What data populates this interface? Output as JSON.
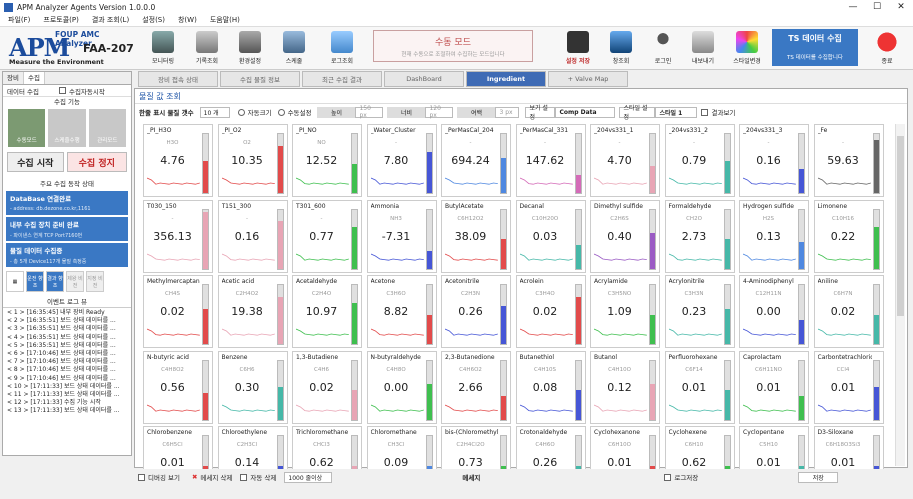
{
  "window": {
    "title": "APM Analyzer Agents Version 1.0.0.0"
  },
  "menu": [
    "파일(F)",
    "프로토콜(P)",
    "결과 조회(L)",
    "설정(S)",
    "창(W)",
    "도움말(H)"
  ],
  "logo": {
    "brand": "APM",
    "subtitle": "FOUP AMC Analyzer",
    "model": "FAA-207",
    "tagline": "Measure the Environment"
  },
  "toolbar": {
    "buttons": [
      "모니터링",
      "기록조회",
      "환경설정",
      "스케줄",
      "로그조회"
    ],
    "mode_title": "수동 모드",
    "mode_sub": "현재 수동으로 조절하여 수집하는 모드입니다",
    "save": "설정 저장",
    "right": [
      "창조회",
      "로그인",
      "내보내기",
      "스타일변경"
    ],
    "exit": "종료",
    "ts_title": "TS 데이터 수집",
    "ts_sub": "TS 데이터를 수집합니다"
  },
  "left": {
    "tabs": [
      "장비",
      "수집"
    ],
    "collect_label": "데이터 수집",
    "auto_label": "수집자동시작",
    "func_title": "수집 기능",
    "modes": [
      "수동모드",
      "스케줄수행",
      "관리모드"
    ],
    "start": "수집 시작",
    "stop": "수집 정지",
    "status_title": "주요 수집 동작 상태",
    "status": [
      {
        "a": "DataBase 연결완료",
        "b": "- address: db.dezone.co.kr,1161"
      },
      {
        "a": "내부 수집 장치 준비 완료",
        "b": "- 파이낸스 연계 TCP Port7160번"
      },
      {
        "a": "물질 데이터 수집중",
        "b": "- 총 5개 Device117개 물질 측정중"
      }
    ],
    "small_btns": [
      "",
      "운전 향조",
      "결과 향조",
      "제왕 비전",
      "지정 비전",
      "",
      "",
      "",
      "",
      ""
    ],
    "log_title": "이벤트 로그 뷰",
    "logs": [
      "< 1 > [16:35:45] 내부 장비 Ready",
      "< 2 > [16:35:51] 보드 상태 데이터를 ...",
      "< 3 > [16:35:51] 보드 상태 데이터를 ...",
      "< 4 > [16:35:51] 보드 상태 데이터를 ...",
      "< 5 > [16:35:51] 보드 상태 데이터를 ...",
      "< 6 > [17:10:46] 보드 상태 데이터를 ...",
      "< 7 > [17:10:46] 보드 상태 데이터를 ...",
      "< 8 > [17:10:46] 보드 상태 데이터를 ...",
      "< 9 > [17:10:46] 보드 상태 데이터를 ...",
      "< 10 > [17:11:33] 보드 상태 데이터를 ...",
      "< 11 > [17:11:33] 보드 상태 데이터를 ...",
      "< 12 > [17:11:33] 수집 기능 시작",
      "< 13 > [17:11:33] 보드 상태 데이터를 ..."
    ]
  },
  "tabs": [
    "장비 접속 상태",
    "수집 물질 정보",
    "최근 수집 결과",
    "DashBoard",
    "Ingredient",
    "+ Valve Map"
  ],
  "main": {
    "title": "물질 값 조회",
    "row_label": "한줄 표시 물질 갯수",
    "row_count": "10 개",
    "auto_size": "자동크기",
    "manual": "수동설정",
    "w_label": "높이",
    "w_val": "150 px",
    "h_label": "너비",
    "h_val": "120 px",
    "gap_label": "여백",
    "gap_val": "3 px",
    "view_label": "보기 설정",
    "view_val": "Comp Data",
    "style_set": "스타일 설정",
    "style_val": "스타일 1",
    "graph": "결과보기"
  },
  "cards": [
    {
      "n": "_PI_H3O",
      "f": "H3O",
      "v": "4.76",
      "c": "#e24b4b",
      "p": 0.55
    },
    {
      "n": "_PI_O2",
      "f": "O2",
      "v": "10.35",
      "c": "#e24b4b",
      "p": 0.8
    },
    {
      "n": "_PI_NO",
      "f": "NO",
      "v": "12.52",
      "c": "#3fbf4f",
      "p": 0.5
    },
    {
      "n": "_Water_Cluster",
      "f": "-",
      "v": "7.80",
      "c": "#4656d6",
      "p": 0.7
    },
    {
      "n": "_PerMasCal_204",
      "f": "-",
      "v": "694.24",
      "c": "#4f88e0",
      "p": 0.6
    },
    {
      "n": "_PerMasCal_331",
      "f": "-",
      "v": "147.62",
      "c": "#d46bb8",
      "p": 0.3
    },
    {
      "n": "_204vs331_1",
      "f": "-",
      "v": "4.70",
      "c": "#e8a5b5",
      "p": 0.45
    },
    {
      "n": "_204vs331_2",
      "f": "-",
      "v": "0.79",
      "c": "#46b8a8",
      "p": 0.55
    },
    {
      "n": "_204vs331_3",
      "f": "-",
      "v": "0.16",
      "c": "#4656d6",
      "p": 0.4
    },
    {
      "n": "_Fe",
      "f": "-",
      "v": "59.63",
      "c": "#666",
      "p": 0.9
    },
    {
      "n": "T030_150",
      "f": "-",
      "v": "356.13",
      "c": "#e8a5b5",
      "p": 0.95
    },
    {
      "n": "T151_300",
      "f": "-",
      "v": "0.16",
      "c": "#e8a5b5",
      "p": 0.8
    },
    {
      "n": "T301_600",
      "f": "-",
      "v": "0.77",
      "c": "#3fbf4f",
      "p": 0.7
    },
    {
      "n": "Ammonia",
      "f": "NH3",
      "v": "-7.31",
      "c": "#4656d6",
      "p": 0.3
    },
    {
      "n": "ButylAcetate",
      "f": "C6H12O2",
      "v": "38.09",
      "c": "#e24b4b",
      "p": 0.5
    },
    {
      "n": "Decanal",
      "f": "C10H20O",
      "v": "0.03",
      "c": "#46b8a8",
      "p": 0.4
    },
    {
      "n": "Dimethyl sulfide",
      "f": "C2H6S",
      "v": "0.40",
      "c": "#9a5bc4",
      "p": 0.6
    },
    {
      "n": "Formaldehyde",
      "f": "CH2O",
      "v": "2.73",
      "c": "#46b8a8",
      "p": 0.5
    },
    {
      "n": "Hydrogen sulfide",
      "f": "H2S",
      "v": "0.13",
      "c": "#4f88e0",
      "p": 0.45
    },
    {
      "n": "Limonene",
      "f": "C10H16",
      "v": "0.22",
      "c": "#3fbf4f",
      "p": 0.7
    },
    {
      "n": "Methylmercaptan",
      "f": "CH4S",
      "v": "0.02",
      "c": "#e24b4b",
      "p": 0.6
    },
    {
      "n": "Acetic acid",
      "f": "C2H4O2",
      "v": "19.38",
      "c": "#e8a5b5",
      "p": 0.8
    },
    {
      "n": "Acetaldehyde",
      "f": "C2H4O",
      "v": "10.97",
      "c": "#3fbf4f",
      "p": 0.7
    },
    {
      "n": "Acetone",
      "f": "C3H6O",
      "v": "8.82",
      "c": "#e24b4b",
      "p": 0.5
    },
    {
      "n": "Acetonitrile",
      "f": "C2H3N",
      "v": "0.26",
      "c": "#4656d6",
      "p": 0.65
    },
    {
      "n": "Acrolein",
      "f": "C3H4O",
      "v": "0.02",
      "c": "#e24b4b",
      "p": 0.8
    },
    {
      "n": "Acrylamide",
      "f": "C3H5NO",
      "v": "1.09",
      "c": "#3fbf4f",
      "p": 0.5
    },
    {
      "n": "Acrylonitrile",
      "f": "C3H3N",
      "v": "0.23",
      "c": "#46b8a8",
      "p": 0.6
    },
    {
      "n": "4-Aminodiphenyl",
      "f": "C12H11N",
      "v": "0.00",
      "c": "#4656d6",
      "p": 0.4
    },
    {
      "n": "Aniline",
      "f": "C6H7N",
      "v": "0.02",
      "c": "#46b8a8",
      "p": 0.5
    },
    {
      "n": "N-butyric acid",
      "f": "C4H8O2",
      "v": "0.56",
      "c": "#e24b4b",
      "p": 0.45
    },
    {
      "n": "Benzene",
      "f": "C6H6",
      "v": "0.30",
      "c": "#46b8a8",
      "p": 0.55
    },
    {
      "n": "1,3-Butadiene",
      "f": "C4H6",
      "v": "0.02",
      "c": "#e8a5b5",
      "p": 0.5
    },
    {
      "n": "N-butyraldehyde",
      "f": "C4H8O",
      "v": "0.00",
      "c": "#3fbf4f",
      "p": 0.6
    },
    {
      "n": "2,3-Butanedione",
      "f": "C4H6O2",
      "v": "2.66",
      "c": "#e24b4b",
      "p": 0.4
    },
    {
      "n": "Butanethiol",
      "f": "C4H10S",
      "v": "0.08",
      "c": "#4656d6",
      "p": 0.5
    },
    {
      "n": "Butanol",
      "f": "C4H10O",
      "v": "0.12",
      "c": "#e8a5b5",
      "p": 0.6
    },
    {
      "n": "Perfluorohexane",
      "f": "C6F14",
      "v": "0.01",
      "c": "#46b8a8",
      "p": 0.5
    },
    {
      "n": "Caprolactam",
      "f": "C6H11NO",
      "v": "0.01",
      "c": "#3fbf4f",
      "p": 0.4
    },
    {
      "n": "Carbontetrachloride",
      "f": "CCl4",
      "v": "0.01",
      "c": "#4656d6",
      "p": 0.55
    },
    {
      "n": "Chlorobenzene",
      "f": "C6H5Cl",
      "v": "0.01",
      "c": "#e24b4b",
      "p": 0.5
    },
    {
      "n": "Chloroethylene",
      "f": "C2H3Cl",
      "v": "0.14",
      "c": "#4656d6",
      "p": 0.5
    },
    {
      "n": "Trichloromethane",
      "f": "CHCl3",
      "v": "0.62",
      "c": "#e8a5b5",
      "p": 0.5
    },
    {
      "n": "Chloromethane",
      "f": "CH3Cl",
      "v": "0.09",
      "c": "#4f88e0",
      "p": 0.5
    },
    {
      "n": "bis-(Chloromethyl) ether",
      "f": "C2H4Cl2O",
      "v": "0.73",
      "c": "#3fbf4f",
      "p": 0.5
    },
    {
      "n": "Crotonaldehyde",
      "f": "C4H6O",
      "v": "0.26",
      "c": "#46b8a8",
      "p": 0.5
    },
    {
      "n": "Cyclohexanone",
      "f": "C6H10O",
      "v": "0.01",
      "c": "#e24b4b",
      "p": 0.5
    },
    {
      "n": "Cyclohexene",
      "f": "C6H10",
      "v": "0.62",
      "c": "#3fbf4f",
      "p": 0.5
    },
    {
      "n": "Cyclopentane",
      "f": "C5H10",
      "v": "0.01",
      "c": "#46b8a8",
      "p": 0.5
    },
    {
      "n": "D3-Siloxane",
      "f": "C6H18O3Si3",
      "v": "0.01",
      "c": "#4656d6",
      "p": 0.5
    }
  ],
  "status": {
    "debug": "디버깅 보기",
    "clear": "메세지 삭제",
    "auto_del": "자동 삭제",
    "max": "1000 줄이상",
    "msg": "메세지",
    "logsave": "로그저장",
    "save": "저장"
  }
}
